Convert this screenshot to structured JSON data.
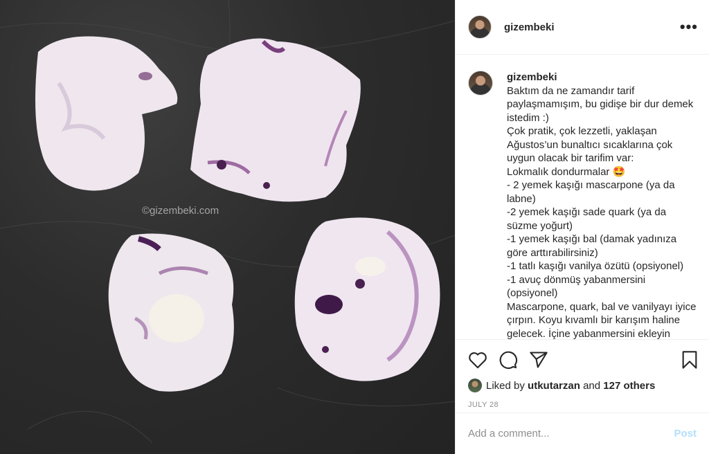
{
  "photo": {
    "watermark": "©gizembeki.com"
  },
  "header": {
    "username": "gizembeki",
    "more_label": "•••"
  },
  "caption": {
    "username": "gizembeki",
    "lines": [
      "Baktım da ne zamandır tarif paylaşmamışım, bu gidişe bir dur demek istedim :)",
      "Çok pratik, çok lezzetli, yaklaşan Ağustos’un bunaltıcı sıcaklarına çok uygun olacak bir tarifim var:",
      "Lokmalık dondurmalar 🤩",
      "- 2 yemek kaşığı mascarpone (ya da labne)",
      "-2 yemek kaşığı sade quark (ya da süzme yoğurt)",
      "-1 yemek kaşığı bal (damak yadınıza göre arttırabilirsiniz)",
      "-1 tatlı kaşığı vanilya özütü (opsiyonel)",
      "-1 avuç dönmüş yabanmersini (opsiyonel)",
      "Mascarpone, quark, bal ve vanilyayı iyice çırpın. Koyu kıvamlı bir karışım haline gelecek. İçine yabanmersini ekleyin hafifçe tekrar karıştırın. Sonra"
    ]
  },
  "actions": {
    "liked_by_prefix": "Liked by",
    "liked_by_user": "utkutarzan",
    "and_text": "and",
    "others": "127 others",
    "date": "JULY 28"
  },
  "comment": {
    "placeholder": "Add a comment...",
    "post_label": "Post"
  },
  "colors": {
    "slate": "#2c2c2c",
    "meringue": "#efe6ee",
    "berry": "#5a2d5e",
    "post_disabled": "#b2dffc"
  }
}
